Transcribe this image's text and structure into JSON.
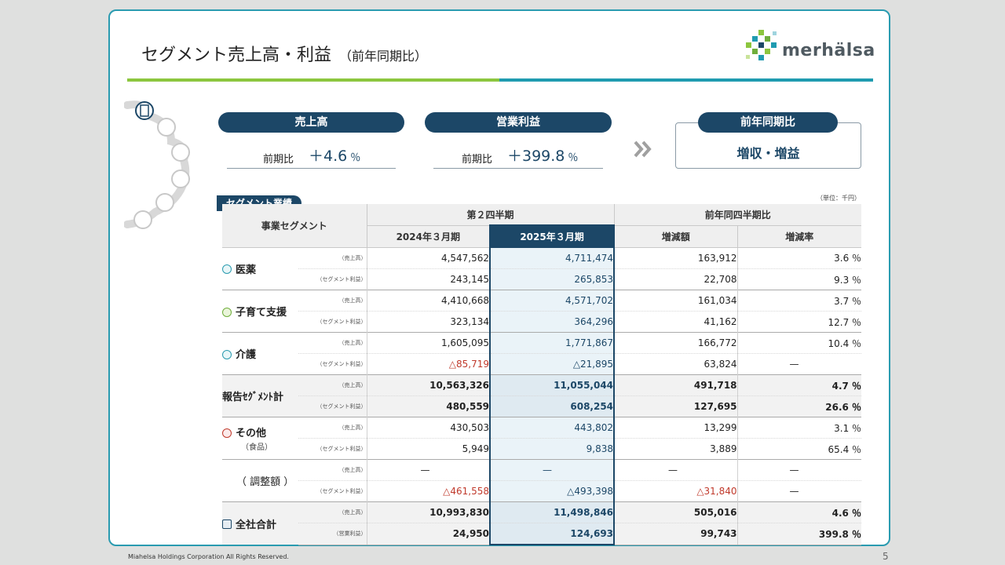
{
  "title": "セグメント売上高・利益",
  "subtitle": "（前年同期比）",
  "logo_text": "merhälsa",
  "kpi": {
    "sales": {
      "label": "売上高",
      "compare_label": "前期比",
      "value": "＋4.6",
      "unit": "％"
    },
    "op_income": {
      "label": "営業利益",
      "compare_label": "前期比",
      "value": "＋399.8",
      "unit": "％"
    },
    "yoy": {
      "label": "前年同期比",
      "value": "増収・増益"
    }
  },
  "colors": {
    "navy": "#1c4767",
    "green": "#8cc63e",
    "teal": "#1f9bb0",
    "negative": "#c0392b"
  },
  "table": {
    "tag": "セグメント業績",
    "unit_note": "（単位：千円）",
    "header": {
      "segment": "事業セグメント",
      "period_group": "第２四半期",
      "yoy_group": "前年同四半期比",
      "col_prev": "2024年３月期",
      "col_cur": "2025年３月期",
      "col_diff": "増減額",
      "col_rate": "増減率"
    },
    "label_sales": "（売上高）",
    "label_segprofit": "（セグメント利益）",
    "label_opincome": "（営業利益）",
    "rows": {
      "medical": {
        "name": "医薬",
        "icon": "pill-icon",
        "sales": [
          "4,547,562",
          "4,711,474",
          "163,912",
          "3.6 ％"
        ],
        "profit": [
          "243,145",
          "265,853",
          "22,708",
          "9.3 ％"
        ]
      },
      "childcare": {
        "name": "子育て支援",
        "icon": "child-icon",
        "sales": [
          "4,410,668",
          "4,571,702",
          "161,034",
          "3.7 ％"
        ],
        "profit": [
          "323,134",
          "364,296",
          "41,162",
          "12.7 ％"
        ]
      },
      "nursing": {
        "name": "介護",
        "icon": "wheelchair-icon",
        "sales": [
          "1,605,095",
          "1,771,867",
          "166,772",
          "10.4 ％"
        ],
        "profit": [
          "△85,719",
          "△21,895",
          "63,824",
          "—"
        ]
      },
      "reported": {
        "name": "報告ｾｸﾞﾒﾝﾄ計",
        "sales": [
          "10,563,326",
          "11,055,044",
          "491,718",
          "4.7 ％"
        ],
        "profit": [
          "480,559",
          "608,254",
          "127,695",
          "26.6 ％"
        ]
      },
      "other": {
        "name": "その他",
        "sub": "（食品）",
        "icon": "fork-knife-icon",
        "sales": [
          "430,503",
          "443,802",
          "13,299",
          "3.1 ％"
        ],
        "profit": [
          "5,949",
          "9,838",
          "3,889",
          "65.4 ％"
        ]
      },
      "adjustment": {
        "name": "（ 調整額 ）",
        "sales": [
          "—",
          "—",
          "—",
          "—"
        ],
        "profit": [
          "△461,558",
          "△493,398",
          "△31,840",
          "—"
        ]
      },
      "total": {
        "name": "全社合計",
        "icon": "building-icon",
        "sales": [
          "10,993,830",
          "11,498,846",
          "505,016",
          "4.6 ％"
        ],
        "profit": [
          "24,950",
          "124,693",
          "99,743",
          "399.8 ％"
        ]
      }
    }
  },
  "footer": "Miahelsa Holdings Corporation All Rights Reserved.",
  "page_number": "5"
}
